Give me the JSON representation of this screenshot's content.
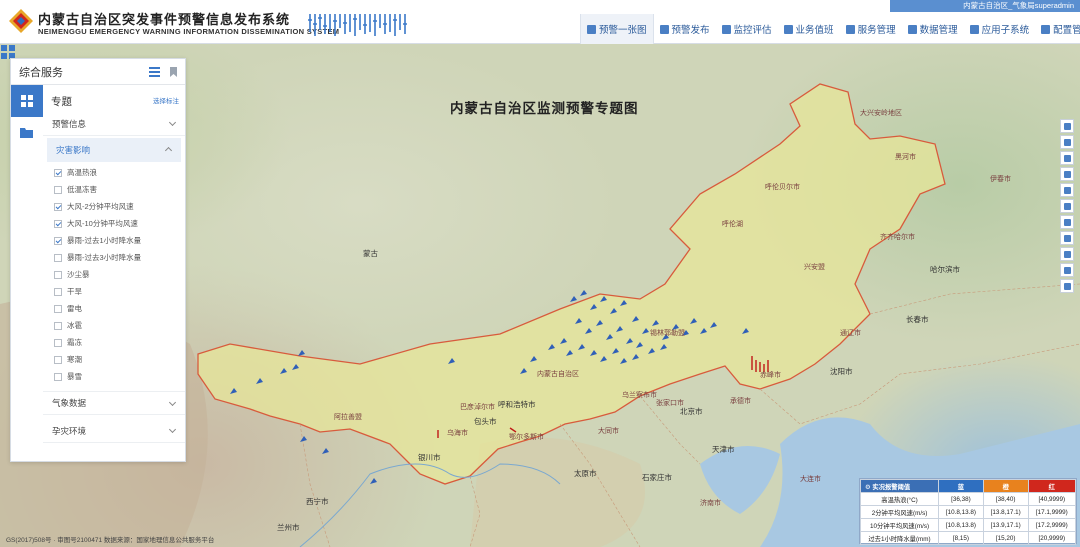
{
  "header": {
    "title_cn": "内蒙古自治区突发事件预警信息发布系统",
    "title_en": "NEIMENGGU EMERGENCY WARNING INFORMATION DISSEMINATION SYSTEM",
    "user_info": "内蒙古自治区_气象局superadmin",
    "nav": [
      {
        "label": "预警一张图",
        "icon": "map-icon",
        "active": true
      },
      {
        "label": "预警发布",
        "icon": "send-icon"
      },
      {
        "label": "监控评估",
        "icon": "chart-icon"
      },
      {
        "label": "业务值班",
        "icon": "calendar-icon"
      },
      {
        "label": "服务管理",
        "icon": "cloud-icon"
      },
      {
        "label": "数据管理",
        "icon": "database-icon"
      },
      {
        "label": "应用子系统",
        "icon": "folder-icon"
      },
      {
        "label": "配置管理",
        "icon": "user-icon"
      }
    ]
  },
  "map": {
    "title": "内蒙古自治区监测预警专题图",
    "copyright": "GS(2017)508号 · 审图号2100471    数据来源：国家地理信息公共服务平台",
    "cities": [
      {
        "name": "蒙古",
        "cls": "blk"
      },
      {
        "name": "内蒙古自治区",
        "cls": ""
      },
      {
        "name": "呼和浩特市",
        "cls": "blk"
      },
      {
        "name": "包头市",
        "cls": "blk"
      },
      {
        "name": "鄂尔多斯市",
        "cls": ""
      },
      {
        "name": "巴彦淖尔市",
        "cls": ""
      },
      {
        "name": "乌海市",
        "cls": ""
      },
      {
        "name": "阿拉善盟",
        "cls": ""
      },
      {
        "name": "银川市",
        "cls": "blk"
      },
      {
        "name": "兰州市",
        "cls": "blk"
      },
      {
        "name": "西宁市",
        "cls": "blk"
      },
      {
        "name": "北京市",
        "cls": "blk"
      },
      {
        "name": "天津市",
        "cls": "blk"
      },
      {
        "name": "石家庄市",
        "cls": "blk"
      },
      {
        "name": "太原市",
        "cls": "blk"
      },
      {
        "name": "济南市",
        "cls": ""
      },
      {
        "name": "沈阳市",
        "cls": "blk"
      },
      {
        "name": "长春市",
        "cls": "blk"
      },
      {
        "name": "哈尔滨市",
        "cls": "blk"
      },
      {
        "name": "赤峰市",
        "cls": ""
      },
      {
        "name": "通辽市",
        "cls": ""
      },
      {
        "name": "兴安盟",
        "cls": ""
      },
      {
        "name": "呼伦贝尔市",
        "cls": ""
      },
      {
        "name": "锡林郭勒盟",
        "cls": ""
      },
      {
        "name": "乌兰察布市",
        "cls": ""
      },
      {
        "name": "大兴安岭地区",
        "cls": ""
      },
      {
        "name": "黑河市",
        "cls": ""
      },
      {
        "name": "伊春市",
        "cls": ""
      },
      {
        "name": "齐齐哈尔市",
        "cls": ""
      },
      {
        "name": "大连市",
        "cls": ""
      },
      {
        "name": "承德市",
        "cls": ""
      },
      {
        "name": "张家口市",
        "cls": ""
      },
      {
        "name": "大同市",
        "cls": ""
      },
      {
        "name": "呼伦湖",
        "cls": ""
      }
    ]
  },
  "panel": {
    "title": "综合服务",
    "topic_label": "专题",
    "topic_more": "选择标注",
    "categories": {
      "warning": "预警信息",
      "disaster": "灾害影响",
      "weather": "气象数据",
      "env": "孕灾环境"
    },
    "items": [
      {
        "label": "高温热浪",
        "checked": true
      },
      {
        "label": "低温冻害",
        "checked": false
      },
      {
        "label": "大风-2分钟平均风速",
        "checked": true
      },
      {
        "label": "大风-10分钟平均风速",
        "checked": true
      },
      {
        "label": "暴雨-过去1小时降水量",
        "checked": true
      },
      {
        "label": "暴雨-过去3小时降水量",
        "checked": false
      },
      {
        "label": "沙尘暴",
        "checked": false
      },
      {
        "label": "干旱",
        "checked": false
      },
      {
        "label": "雷电",
        "checked": false
      },
      {
        "label": "冰雹",
        "checked": false
      },
      {
        "label": "霜冻",
        "checked": false
      },
      {
        "label": "寒潮",
        "checked": false
      },
      {
        "label": "暴雪",
        "checked": false
      }
    ]
  },
  "legend": {
    "title": "实况报警阈值",
    "levels": [
      "蓝",
      "橙",
      "红"
    ],
    "level_colors": [
      "#2f6fc0",
      "#e8821e",
      "#d0271d"
    ],
    "rows": [
      {
        "name": "高温热浪(°C)",
        "values": [
          "[36,38)",
          "[38,40)",
          "[40,9999)"
        ]
      },
      {
        "name": "2分钟平均风速(m/s)",
        "values": [
          "[10.8,13.8)",
          "[13.8,17.1)",
          "[17.1,9999)"
        ]
      },
      {
        "name": "10分钟平均风速(m/s)",
        "values": [
          "[10.8,13.8)",
          "[13.9,17.1)",
          "[17.2,9999)"
        ]
      },
      {
        "name": "过去1小时降水量(mm)",
        "values": [
          "[8,15)",
          "[15,20)",
          "[20,9999)"
        ]
      }
    ]
  }
}
